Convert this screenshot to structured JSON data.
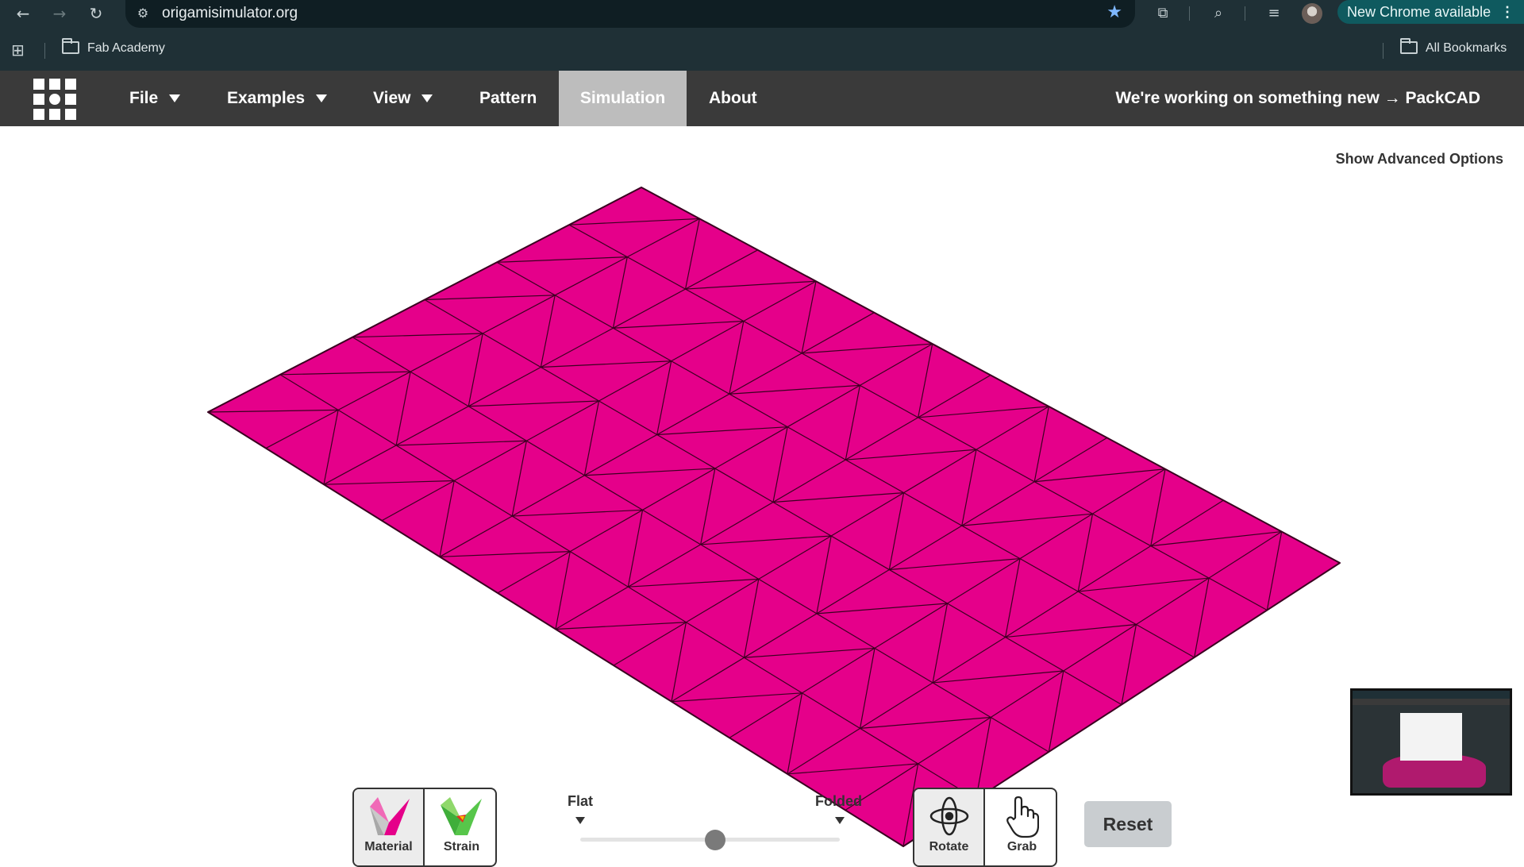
{
  "browser": {
    "url": "origamisimulator.org",
    "update_label": "New Chrome available",
    "update_menu": "⋮",
    "icons": [
      "back-arrow-icon",
      "forward-arrow-icon",
      "reload-icon",
      "site-settings-icon",
      "bookmark-star-icon",
      "extensions-icon",
      "search-tabs-icon",
      "reading-list-icon",
      "profile-avatar"
    ]
  },
  "bookmarks": {
    "items": [
      {
        "label": "Fab Academy"
      }
    ],
    "all_label": "All Bookmarks"
  },
  "nav": {
    "menus": [
      {
        "label": "File",
        "has_dropdown": true
      },
      {
        "label": "Examples",
        "has_dropdown": true
      },
      {
        "label": "View",
        "has_dropdown": true
      },
      {
        "label": "Pattern",
        "has_dropdown": false
      },
      {
        "label": "Simulation",
        "has_dropdown": false,
        "active": true
      },
      {
        "label": "About",
        "has_dropdown": false
      }
    ],
    "promo": "We're working on something new → PackCAD"
  },
  "advanced_options": "Show Advanced Options",
  "sheet": {
    "color": "#e5008a",
    "edge_color": "#3a0020"
  },
  "controls": {
    "material_label": "Material",
    "strain_label": "Strain",
    "fold_start_label": "Flat",
    "fold_end_label": "Folded",
    "fold_percent": 0.52,
    "rotate_label": "Rotate",
    "grab_label": "Grab",
    "reset_label": "Reset"
  },
  "colors": {
    "nav_bg": "#3a3a3a",
    "active_tab": "#bdbdbd",
    "chrome_bg": "#1f3036",
    "update_btn": "#0f5a5f"
  }
}
